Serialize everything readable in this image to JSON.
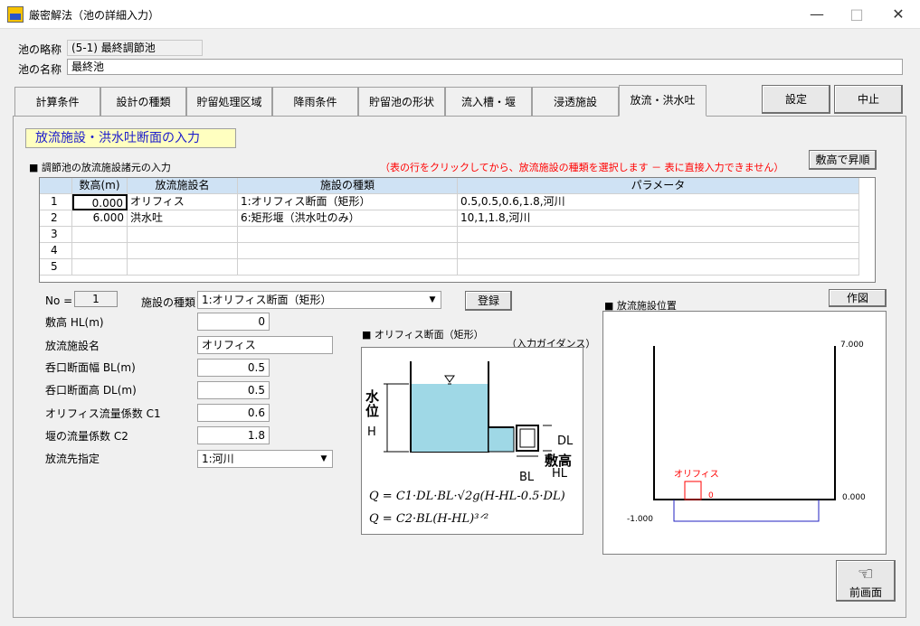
{
  "window": {
    "title": "厳密解法（池の詳細入力）",
    "min_icon": "—",
    "max_icon": "□",
    "close_icon": "✕"
  },
  "header": {
    "pond_abbr_label": "池の略称",
    "pond_abbr_value": "(5-1) 最終調節池",
    "pond_name_label": "池の名称",
    "pond_name_value": "最終池"
  },
  "tabs": [
    {
      "label": "計算条件"
    },
    {
      "label": "設計の種類"
    },
    {
      "label": "貯留処理区域"
    },
    {
      "label": "降雨条件"
    },
    {
      "label": "貯留池の形状"
    },
    {
      "label": "流入槽・堰"
    },
    {
      "label": "浸透施設"
    },
    {
      "label": "放流・洪水吐"
    }
  ],
  "actions": {
    "settings": "設定",
    "cancel": "中止",
    "back": "前画面"
  },
  "section": {
    "banner": "放流施設・洪水吐断面の入力",
    "list_title": "調節池の放流施設諸元の入力",
    "hint": "（表の行をクリックしてから、放流施設の種類を選択します － 表に直接入力できません）",
    "sort_button": "敷高で昇順"
  },
  "grid": {
    "headers": [
      "数高(m)",
      "放流施設名",
      "施設の種類",
      "パラメータ"
    ],
    "rows": [
      {
        "no": "1",
        "height": "0.000",
        "name": "オリフィス",
        "type": "1:オリフィス断面（矩形）",
        "params": "0.5,0.5,0.6,1.8,河川"
      },
      {
        "no": "2",
        "height": "6.000",
        "name": "洪水吐",
        "type": "6:矩形堰（洪水吐のみ）",
        "params": "10,1,1.8,河川"
      },
      {
        "no": "3",
        "height": "",
        "name": "",
        "type": "",
        "params": ""
      },
      {
        "no": "4",
        "height": "",
        "name": "",
        "type": "",
        "params": ""
      },
      {
        "no": "5",
        "height": "",
        "name": "",
        "type": "",
        "params": ""
      }
    ]
  },
  "form": {
    "no_label": "No =",
    "no_value": "1",
    "facility_type_label": "施設の種類",
    "facility_type_value": "1:オリフィス断面（矩形）",
    "register_button": "登録",
    "height_label": "敷高 HL(m)",
    "height_value": "0",
    "name_label": "放流施設名",
    "name_value": "オリフィス",
    "bl_label": "呑口断面幅 BL(m)",
    "bl_value": "0.5",
    "dl_label": "呑口断面高 DL(m)",
    "dl_value": "0.5",
    "c1_label": "オリフィス流量係数 C1",
    "c1_value": "0.6",
    "c2_label": "堰の流量係数 C2",
    "c2_value": "1.8",
    "dest_label": "放流先指定",
    "dest_value": "1:河川"
  },
  "guide": {
    "title": "オリフィス断面（矩形）",
    "subtitle": "（入力ガイダンス）",
    "water_level": "水位",
    "h": "H",
    "dl": "DL",
    "bl": "BL",
    "sill": "敷高",
    "hl": "HL",
    "formula1": "Q = C1·DL·BL·√2g(H-HL-0.5·DL)",
    "formula2": "Q = C2·BL(H-HL)³ᐟ²"
  },
  "position_panel": {
    "title": "放流施設位置",
    "draw_button": "作図",
    "top_level": "7.000",
    "zero_level": "0.000",
    "bottom_level": "-1.000",
    "orifice_label": "オリフィス",
    "orifice_mark": "0"
  },
  "colors": {
    "accent_red": "#ff0000",
    "banner_text": "#1c1ccc",
    "water": "#9fd8e6",
    "grid_header": "#cfe2f4",
    "pipe_blue": "#2020c0"
  }
}
